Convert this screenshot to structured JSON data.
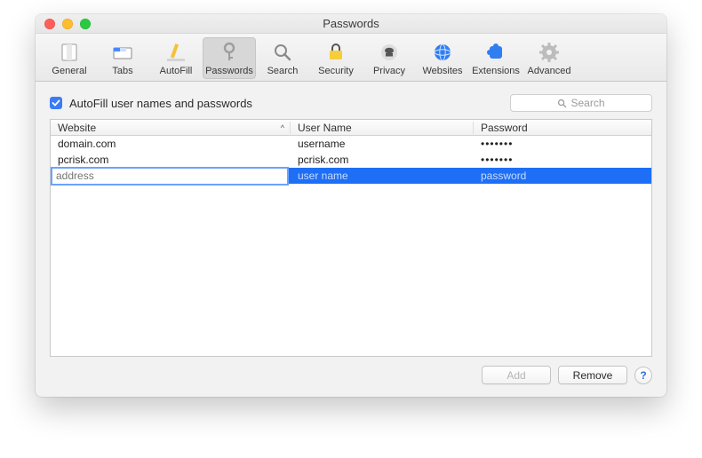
{
  "window": {
    "title": "Passwords"
  },
  "toolbar": {
    "active_index": 3,
    "items": [
      {
        "label": "General"
      },
      {
        "label": "Tabs"
      },
      {
        "label": "AutoFill"
      },
      {
        "label": "Passwords"
      },
      {
        "label": "Search"
      },
      {
        "label": "Security"
      },
      {
        "label": "Privacy"
      },
      {
        "label": "Websites"
      },
      {
        "label": "Extensions"
      },
      {
        "label": "Advanced"
      }
    ]
  },
  "autofill_checkbox": {
    "checked": true,
    "label": "AutoFill user names and passwords"
  },
  "search": {
    "placeholder": "Search",
    "value": ""
  },
  "columns": {
    "website": "Website",
    "username": "User Name",
    "password": "Password"
  },
  "rows": [
    {
      "website": "domain.com",
      "username": "username",
      "password_mask": "•••••••"
    },
    {
      "website": "pcrisk.com",
      "username": "pcrisk.com",
      "password_mask": "•••••••"
    }
  ],
  "editing_row": {
    "website_placeholder": "address",
    "username_placeholder": "user name",
    "password_placeholder": "password"
  },
  "buttons": {
    "add": "Add",
    "remove": "Remove"
  },
  "help": "?"
}
